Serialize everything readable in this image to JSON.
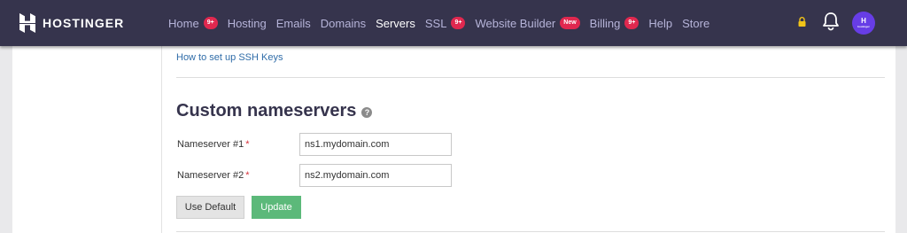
{
  "header": {
    "brand": "HOSTINGER",
    "nav": [
      {
        "label": "Home",
        "badge": "9+"
      },
      {
        "label": "Hosting",
        "badge": ""
      },
      {
        "label": "Emails",
        "badge": ""
      },
      {
        "label": "Domains",
        "badge": ""
      },
      {
        "label": "Servers",
        "badge": "",
        "active": true
      },
      {
        "label": "SSL",
        "badge": "9+"
      },
      {
        "label": "Website Builder",
        "badge": "New"
      },
      {
        "label": "Billing",
        "badge": "9+"
      },
      {
        "label": "Help",
        "badge": ""
      },
      {
        "label": "Store",
        "badge": ""
      }
    ],
    "avatar_initial": "H",
    "avatar_sub": "hostinger",
    "icons": {
      "lock": "lock-icon",
      "bell": "bell-icon",
      "logo": "hostinger-logo-icon"
    }
  },
  "content": {
    "ssh_link": "How to set up SSH Keys",
    "section_title": "Custom nameservers",
    "help_icon_glyph": "?",
    "fields": [
      {
        "label": "Nameserver #1",
        "required": "*",
        "value": "ns1.mydomain.com"
      },
      {
        "label": "Nameserver #2",
        "required": "*",
        "value": "ns2.mydomain.com"
      }
    ],
    "buttons": {
      "use_default": "Use Default",
      "update": "Update"
    }
  },
  "colors": {
    "topbar": "#36344d",
    "accent": "#673de6",
    "badge": "#e0284f",
    "update_button": "#5cb97a",
    "link": "#2f6ca8"
  }
}
